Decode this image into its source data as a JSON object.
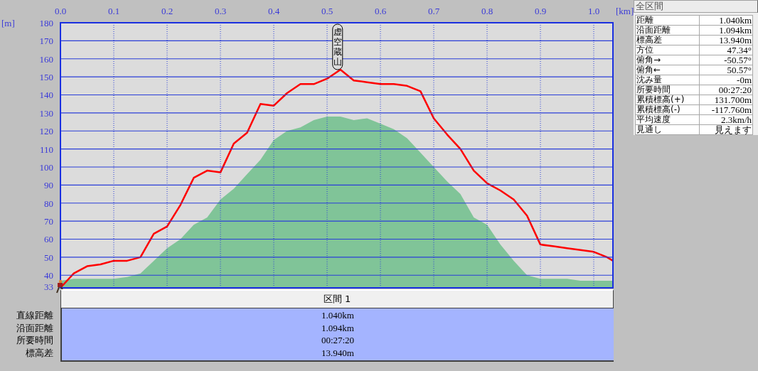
{
  "chart": {
    "chart_data": {
      "type": "line",
      "xlabel": "[km]",
      "ylabel": "[m]",
      "x": [
        0,
        0.025,
        0.05,
        0.075,
        0.1,
        0.125,
        0.15,
        0.175,
        0.2,
        0.225,
        0.25,
        0.275,
        0.3,
        0.325,
        0.35,
        0.375,
        0.4,
        0.425,
        0.45,
        0.475,
        0.5,
        0.525,
        0.55,
        0.575,
        0.6,
        0.625,
        0.65,
        0.675,
        0.7,
        0.725,
        0.75,
        0.775,
        0.8,
        0.825,
        0.85,
        0.875,
        0.9,
        0.925,
        0.95,
        0.975,
        1.0,
        1.025,
        1.036
      ],
      "series": [
        {
          "type": "area",
          "color": "#80c498",
          "values": [
            37,
            38,
            38,
            38,
            38,
            39,
            41,
            48,
            55,
            60,
            68,
            72,
            82,
            88,
            96,
            104,
            115,
            120,
            122,
            126,
            128,
            128,
            126,
            127,
            124,
            121,
            116,
            108,
            100,
            92,
            85,
            72,
            68,
            57,
            48,
            40,
            38,
            38,
            38,
            37,
            37,
            37,
            37
          ]
        },
        {
          "type": "line",
          "color": "#ff0000",
          "values": [
            33,
            41,
            45,
            46,
            48,
            48,
            50,
            63,
            67,
            79,
            94,
            98,
            97,
            113,
            119,
            135,
            134,
            141,
            146,
            146,
            149,
            154,
            148,
            147,
            146,
            146,
            145,
            142,
            127,
            118,
            110,
            98,
            91,
            87,
            82,
            73,
            57,
            56,
            55,
            54,
            53,
            50,
            48
          ]
        }
      ],
      "grid": true,
      "xlim": [
        0,
        1.036
      ],
      "ylim": [
        33,
        180
      ],
      "xticks": [
        {
          "value": 0,
          "label": "0.0"
        },
        {
          "value": 0.1,
          "label": "0.1"
        },
        {
          "value": 0.2,
          "label": "0.2"
        },
        {
          "value": 0.3,
          "label": "0.3"
        },
        {
          "value": 0.4,
          "label": "0.4"
        },
        {
          "value": 0.5,
          "label": "0.5"
        },
        {
          "value": 0.6,
          "label": "0.6"
        },
        {
          "value": 0.7,
          "label": "0.7"
        },
        {
          "value": 0.8,
          "label": "0.8"
        },
        {
          "value": 0.9,
          "label": "0.9"
        },
        {
          "value": 1.0,
          "label": "1.0"
        }
      ],
      "yticks": [
        33,
        40,
        50,
        60,
        70,
        80,
        90,
        100,
        110,
        120,
        130,
        140,
        150,
        160,
        170,
        180
      ],
      "annotations": [
        "虚空蔵山"
      ]
    }
  },
  "sections": {
    "header": "区間 1",
    "rows": [
      {
        "label": "直線距離",
        "value": "1.040km"
      },
      {
        "label": "沿面距離",
        "value": "1.094km"
      },
      {
        "label": "所要時間",
        "value": "00:27:20"
      },
      {
        "label": "標高差",
        "value": "13.940m"
      }
    ]
  },
  "summary": {
    "title": "全区間",
    "rows": [
      {
        "label": "距離",
        "value": "1.040km"
      },
      {
        "label": "沿面距離",
        "value": "1.094km"
      },
      {
        "label": "標高差",
        "value": "13.940m"
      },
      {
        "label": "方位",
        "value": "47.34°"
      },
      {
        "label": "俯角→",
        "value": "-50.57°"
      },
      {
        "label": "俯角←",
        "value": "50.57°"
      },
      {
        "label": "沈み量",
        "value": "-0m"
      },
      {
        "label": "所要時間",
        "value": "00:27:20"
      },
      {
        "label": "累積標高(+)",
        "value": "131.700m"
      },
      {
        "label": "累積標高(-)",
        "value": "-117.760m"
      },
      {
        "label": "平均速度",
        "value": "2.3km/h"
      },
      {
        "label": "見通し",
        "value": "見えます"
      }
    ]
  }
}
